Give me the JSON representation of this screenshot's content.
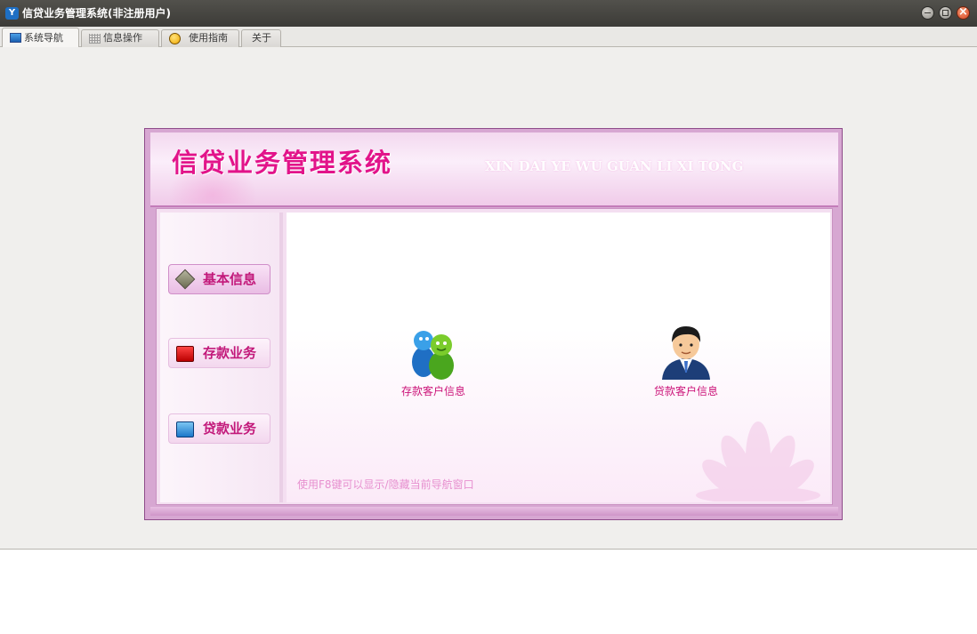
{
  "window": {
    "title": "信贷业务管理系统(非注册用户)",
    "app_icon_text": "Y"
  },
  "tabs": [
    {
      "label": "系统导航",
      "icon": "monitor-icon",
      "active": true
    },
    {
      "label": "信息操作",
      "icon": "grid-icon",
      "active": false
    },
    {
      "label": "使用指南",
      "icon": "smiley-icon",
      "active": false
    },
    {
      "label": "关于",
      "icon": "",
      "active": false
    }
  ],
  "banner": {
    "title": "信贷业务管理系统",
    "subtitle": "XIN DAI YE WU GUAN LI XI TONG"
  },
  "nav": [
    {
      "label": "基本信息",
      "icon": "info-diamond-icon",
      "active": true
    },
    {
      "label": "存款业务",
      "icon": "deposit-icon",
      "active": false
    },
    {
      "label": "贷款业务",
      "icon": "loan-monitor-icon",
      "active": false
    }
  ],
  "tiles": [
    {
      "label": "存款客户信息",
      "icon": "two-users-icon"
    },
    {
      "label": "贷款客户信息",
      "icon": "businessman-icon"
    }
  ],
  "hint": "使用F8键可以显示/隐藏当前导航窗口",
  "colors": {
    "accent": "#e2148a",
    "panel_border": "#8e4c8a",
    "banner_bg": "#f3d9ef"
  }
}
